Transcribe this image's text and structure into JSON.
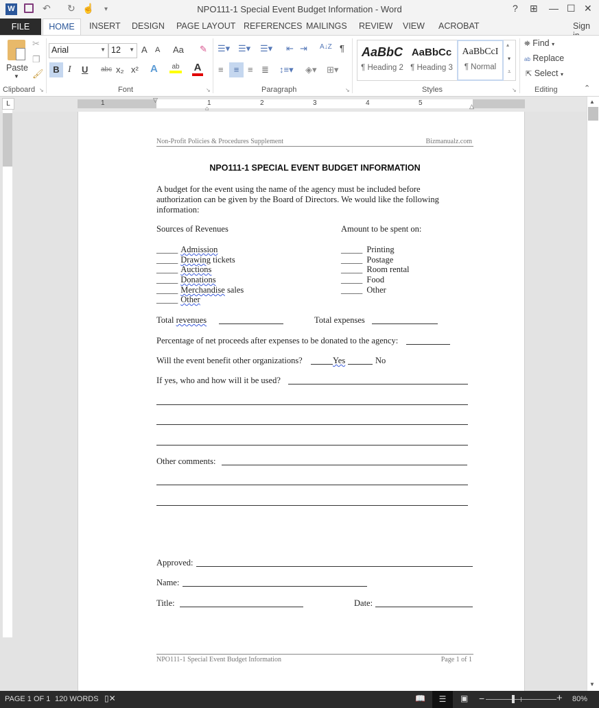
{
  "window": {
    "title": "NPO111-1 Special Event Budget Information - Word",
    "help": "?",
    "ribbon_display": "⊞",
    "minimize": "—",
    "maximize": "☐",
    "close": "✕"
  },
  "quick_access": {
    "app_icon": "W",
    "save_icon": "💾",
    "undo_icon": "↶",
    "redo_icon": "↻",
    "touch_icon": "☝",
    "customize_icon": "▾"
  },
  "tabs": {
    "file": "FILE",
    "items": [
      "HOME",
      "INSERT",
      "DESIGN",
      "PAGE LAYOUT",
      "REFERENCES",
      "MAILINGS",
      "REVIEW",
      "VIEW",
      "ACROBAT"
    ],
    "sign_in": "Sign in"
  },
  "ribbon": {
    "clipboard": {
      "paste": "Paste",
      "label": "Clipboard"
    },
    "font": {
      "name": "Arial",
      "size": "12",
      "label": "Font",
      "grow": "A",
      "shrink": "A",
      "case": "Aa",
      "bold": "B",
      "italic": "I",
      "underline": "U",
      "strike": "abc",
      "sub": "x₂",
      "sup": "x²",
      "effects": "A",
      "highlight": "ab",
      "color": "A"
    },
    "paragraph": {
      "label": "Paragraph",
      "pilcrow": "¶",
      "sort": "A↓Z"
    },
    "styles": {
      "label": "Styles",
      "items": [
        {
          "preview": "AaBbC",
          "name": "¶ Heading 2"
        },
        {
          "preview": "AaBbCc",
          "name": "¶ Heading 3"
        },
        {
          "preview": "AaBbCcI",
          "name": "¶ Normal"
        }
      ]
    },
    "editing": {
      "label": "Editing",
      "find": "Find",
      "replace": "Replace",
      "select": "Select"
    }
  },
  "ruler": {
    "numbers": [
      "1",
      "1",
      "2",
      "3",
      "4",
      "5"
    ]
  },
  "document": {
    "header_left": "Non-Profit Policies & Procedures Supplement",
    "header_right": "Bizmanualz.com",
    "title": "NPO111-1 SPECIAL EVENT BUDGET INFORMATION",
    "intro": [
      "A budget for the event using the name of the agency must be included before",
      "authorization can be given by the Board of Directors. We would like the following",
      "information:"
    ],
    "revenues_heading": "Sources of Revenues",
    "revenues": [
      {
        "main": "Admission",
        "rest": ""
      },
      {
        "main": "Drawing",
        "rest": " tickets"
      },
      {
        "main": "Auctions",
        "rest": ""
      },
      {
        "main": "Donations",
        "rest": ""
      },
      {
        "main": "Merchandise",
        "rest": " sales"
      },
      {
        "main": "Other",
        "rest": ""
      }
    ],
    "expenses_heading": "Amount to be spent on:",
    "expenses": [
      "Printing",
      "Postage",
      "Room rental",
      "Food",
      "Other"
    ],
    "total_revenues_label": "Total",
    "total_revenues_word": "revenues",
    "total_expenses_label": "Total expenses",
    "percentage_label": "Percentage of net proceeds after expenses to be donated to the agency:",
    "benefit_label": "Will the event benefit other organizations?",
    "yes": "Yes",
    "no": "No",
    "if_yes_label": "If yes, who and how will it be used?",
    "comments_label": "Other comments:",
    "approved_label": "Approved:",
    "name_label": "Name:",
    "title_label": "Title:",
    "date_label": "Date:",
    "footer_left": "NPO111-1 Special Event Budget Information",
    "footer_right": "Page 1 of 1"
  },
  "status": {
    "page": "PAGE 1 OF 1",
    "words": "120 WORDS",
    "zoom": "80%",
    "zoom_minus": "−",
    "zoom_plus": "+"
  }
}
